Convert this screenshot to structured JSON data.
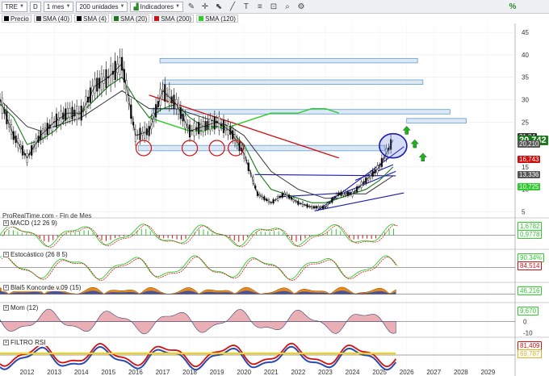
{
  "toolbar": {
    "symbol": "TRE",
    "period_letter": "D",
    "timeframe": "1 mes",
    "units": "200 unidades",
    "indicators_label": "Indicadores"
  },
  "legend": [
    {
      "label": "Precio",
      "color": "#000000",
      "type": "candles"
    },
    {
      "label": "SMA (40)",
      "color": "#333333"
    },
    {
      "label": "SMA (4)",
      "color": "#000000"
    },
    {
      "label": "SMA (20)",
      "color": "#1a7a1a"
    },
    {
      "label": "SMA (200)",
      "color": "#d01010"
    },
    {
      "label": "SMA (120)",
      "color": "#2ecc2e"
    }
  ],
  "provider_text": "ProRealTime.com - Fin de Mes",
  "price_axis": {
    "ticks": [
      "45",
      "40",
      "35",
      "30",
      "25",
      "15",
      "10",
      "5"
    ],
    "min": 4,
    "max": 47
  },
  "price_tags": [
    {
      "text": "21,84",
      "value": 21.84,
      "color": "#333333"
    },
    {
      "text": "20,742",
      "value": 20.742,
      "color": "#1a7a1a",
      "big": true
    },
    {
      "text": "20,210",
      "value": 20.21,
      "color": "#555555"
    },
    {
      "text": "16,743",
      "value": 16.743,
      "color": "#d01010"
    },
    {
      "text": "13,336",
      "value": 13.336,
      "color": "#555555"
    },
    {
      "text": "10,725",
      "value": 10.725,
      "color": "#2ecc2e"
    }
  ],
  "x_axis": {
    "labels": [
      "2012",
      "2013",
      "2014",
      "2015",
      "2016",
      "2017",
      "2018",
      "2019",
      "2020",
      "2021",
      "2022",
      "2023",
      "2024",
      "2025",
      "2026",
      "2027",
      "2028",
      "2029"
    ],
    "start": 2011,
    "end": 2030
  },
  "chart_data": {
    "type": "line",
    "x": [
      2011.0,
      2011.5,
      2012.0,
      2012.5,
      2013.0,
      2013.5,
      2014.0,
      2014.5,
      2015.0,
      2015.5,
      2016.0,
      2016.5,
      2017.0,
      2017.5,
      2018.0,
      2018.5,
      2019.0,
      2019.5,
      2020.0,
      2020.5,
      2021.0,
      2021.5,
      2022.0,
      2022.5,
      2023.0,
      2023.5,
      2024.0,
      2024.5,
      2025.0,
      2025.5
    ],
    "series": [
      {
        "name": "Precio",
        "values": [
          30,
          22,
          17,
          22,
          25,
          27,
          27,
          33,
          35,
          38,
          22,
          23,
          32,
          29,
          23,
          24,
          25,
          23,
          18,
          9,
          7,
          9,
          7,
          6,
          6,
          9,
          9,
          12,
          15,
          21
        ]
      },
      {
        "name": "SMA (20)",
        "values": [
          29,
          26,
          20,
          21,
          23,
          26,
          27,
          30,
          33,
          35,
          30,
          26,
          28,
          29,
          26,
          24,
          24,
          23,
          20,
          14,
          10,
          9,
          8,
          7,
          7,
          8,
          9,
          10,
          12,
          15
        ]
      },
      {
        "name": "SMA (40)",
        "values": [
          30,
          27,
          24,
          23,
          24,
          25,
          26,
          28,
          30,
          32,
          30,
          28,
          28,
          28,
          27,
          26,
          25,
          24,
          22,
          18,
          14,
          12,
          10,
          9,
          8,
          8,
          9,
          9,
          11,
          13
        ]
      },
      {
        "name": "SMA (120)",
        "values": [
          26,
          25,
          24,
          23,
          23,
          24,
          24,
          25,
          26,
          27,
          27,
          27,
          28,
          28,
          27
        ]
      },
      {
        "name": "SMA (200)",
        "values": [
          31,
          30,
          29,
          28,
          27,
          26,
          25,
          24,
          23,
          22,
          21,
          20,
          19,
          18,
          17
        ]
      }
    ],
    "sma_long_x_start": 2016.5,
    "ylim": [
      4,
      47
    ]
  },
  "annotations": {
    "resistance_boxes": [
      {
        "y_low": 38.2,
        "y_high": 39.2,
        "x_from": 2016.9,
        "x_to": 2026.4
      },
      {
        "y_low": 33.4,
        "y_high": 34.4,
        "x_from": 2017.0,
        "x_to": 2026.6
      },
      {
        "y_low": 26.8,
        "y_high": 27.8,
        "x_from": 2016.6,
        "x_to": 2027.6
      },
      {
        "y_low": 24.8,
        "y_high": 25.8,
        "x_from": 2026.0,
        "x_to": 2028.2
      }
    ],
    "support_band": {
      "y_low": 18.6,
      "y_high": 19.8,
      "x_from": 2016.1,
      "x_to": 2025.2
    },
    "circles": [
      2016.3,
      2018.0,
      2019.0,
      2019.7
    ],
    "big_circle": {
      "x": 2025.5,
      "y": 19.7
    },
    "up_arrows": [
      {
        "x": 2026.0,
        "y": 23.0
      },
      {
        "x": 2026.3,
        "y": 20.0
      },
      {
        "x": 2026.6,
        "y": 17.0
      }
    ]
  },
  "panels": [
    {
      "name": "MACD (12 26 9)",
      "tags": [
        {
          "text": "1,6782",
          "color": "#2ecc2e"
        },
        {
          "text": "0,9778",
          "color": "#2ecc2e"
        }
      ],
      "ticks": []
    },
    {
      "name": "Estocástico (26 8 5)",
      "tags": [
        {
          "text": "90,34%",
          "color": "#2ecc2e"
        },
        {
          "text": "84,514",
          "color": "#d01010"
        }
      ],
      "ticks": []
    },
    {
      "name": "Blai5 Koncorde v.09 (15)",
      "tags": [
        {
          "text": "46,216",
          "color": "#2ecc2e"
        }
      ],
      "ticks": []
    },
    {
      "name": "Mom (12)",
      "tags": [
        {
          "text": "9,670",
          "color": "#2ecc2e"
        }
      ],
      "ticks": [
        "0",
        "-10"
      ]
    },
    {
      "name": "FILTRO RSI",
      "tags": [
        {
          "text": "81,409",
          "color": "#d01010"
        },
        {
          "text": "69,787",
          "color": "#e0b020"
        }
      ],
      "ticks": []
    }
  ],
  "colors": {
    "accent": "#2a7ab8",
    "grid": "#e6e6e6",
    "box_fill": "#dbe8f6",
    "box_stroke": "#6a9ccc"
  }
}
